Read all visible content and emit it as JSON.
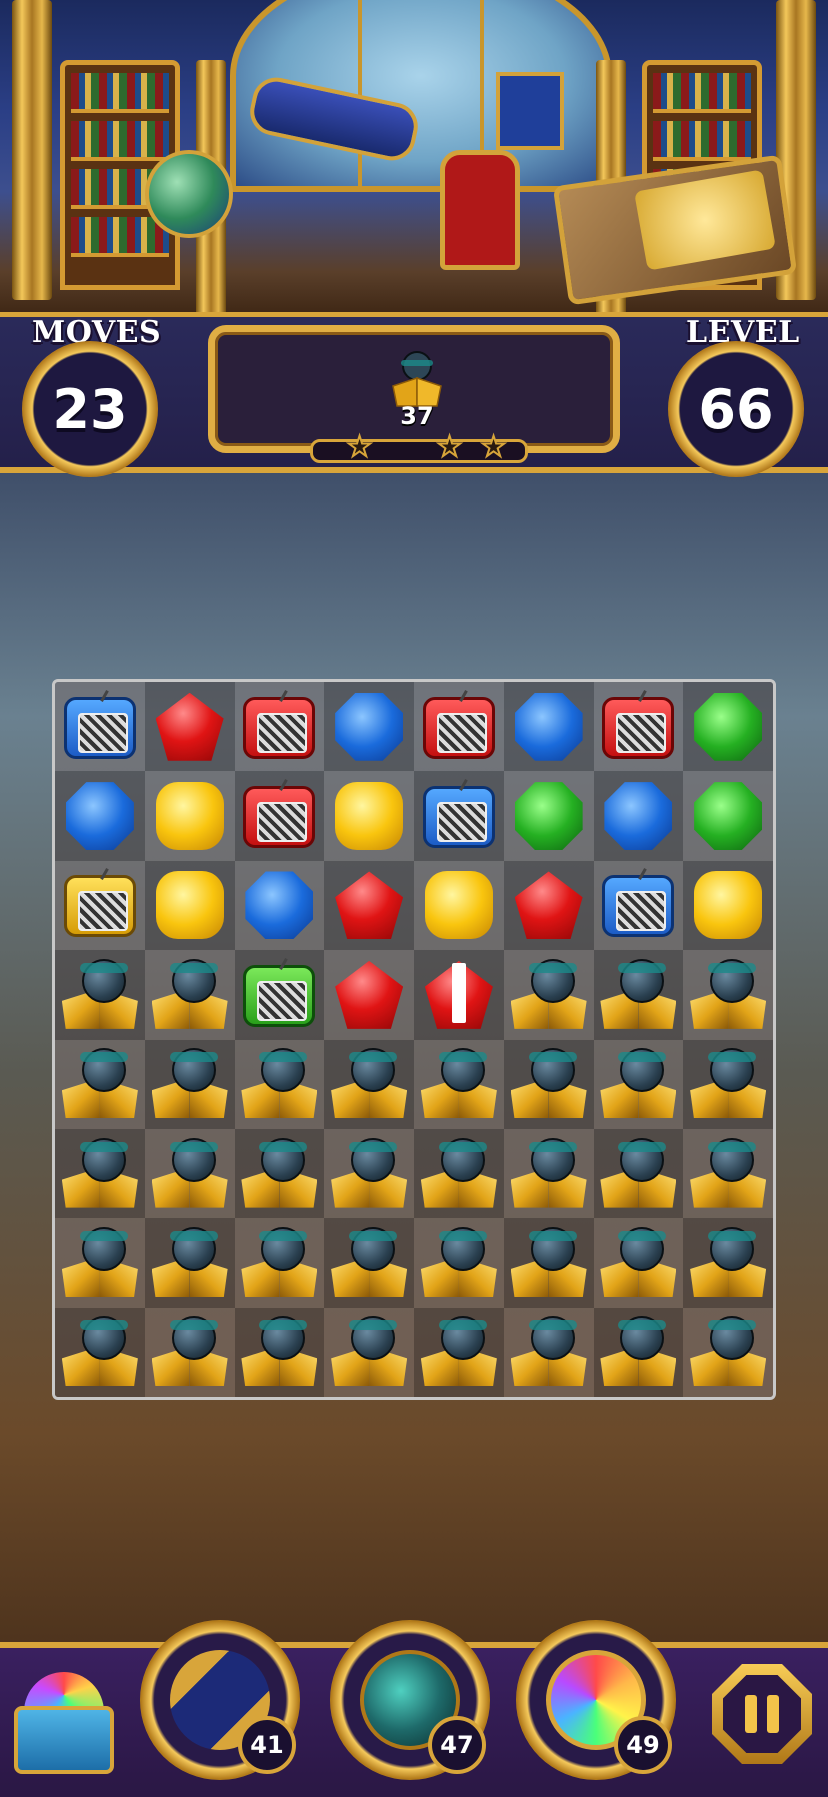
{
  "hud": {
    "moves_label": "MOVES",
    "moves_value": "23",
    "level_label": "LEVEL",
    "level_value": "66",
    "goal": {
      "icon": "golden-acorn-icon",
      "count": "37"
    },
    "stars": {
      "filled": 0,
      "total": 3
    }
  },
  "board": {
    "rows": 8,
    "cols": 8,
    "grid": [
      [
        "radio-blue",
        "gem-red",
        "radio-red",
        "gem-blue",
        "radio-red",
        "gem-blue",
        "radio-red",
        "gem-green"
      ],
      [
        "gem-blue",
        "gem-yellow",
        "radio-red",
        "gem-yellow",
        "radio-blue",
        "gem-green",
        "gem-blue",
        "gem-green"
      ],
      [
        "radio-yellow",
        "gem-yellow",
        "gem-blue",
        "gem-red",
        "gem-yellow",
        "gem-red",
        "radio-blue",
        "gem-yellow"
      ],
      [
        "acorn",
        "acorn",
        "radio-green",
        "gem-red",
        "gem-red-striped",
        "acorn",
        "acorn",
        "acorn"
      ],
      [
        "acorn",
        "acorn",
        "acorn",
        "acorn",
        "acorn",
        "acorn",
        "acorn",
        "acorn"
      ],
      [
        "acorn",
        "acorn",
        "acorn",
        "acorn",
        "acorn",
        "acorn",
        "acorn",
        "acorn"
      ],
      [
        "acorn",
        "acorn",
        "acorn",
        "acorn",
        "acorn",
        "acorn",
        "acorn",
        "acorn"
      ],
      [
        "acorn",
        "acorn",
        "acorn",
        "acorn",
        "acorn",
        "acorn",
        "acorn",
        "acorn"
      ]
    ]
  },
  "boosters": [
    {
      "name": "cannon-booster",
      "icon": "cannon-icon",
      "count": "41"
    },
    {
      "name": "globe-cage-booster",
      "icon": "caged-globe-icon",
      "count": "47"
    },
    {
      "name": "clock-booster",
      "icon": "rainbow-clock-icon",
      "count": "49"
    }
  ],
  "chest": {
    "icon": "gem-chest-icon"
  },
  "pause": {
    "icon": "pause-icon"
  }
}
